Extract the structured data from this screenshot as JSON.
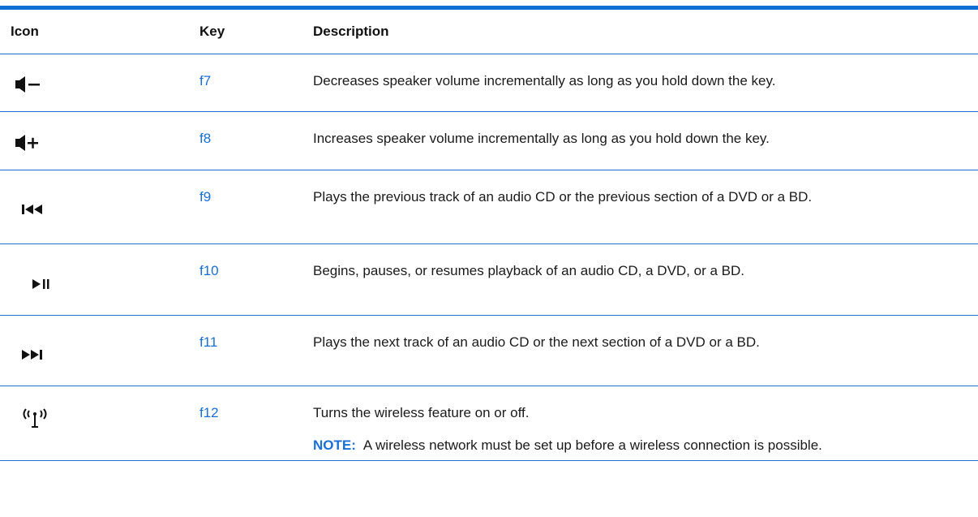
{
  "table": {
    "headers": {
      "icon": "Icon",
      "key": "Key",
      "description": "Description"
    },
    "rows": [
      {
        "icon": "volume-down-icon",
        "key": "f7",
        "description": "Decreases speaker volume incrementally as long as you hold down the key."
      },
      {
        "icon": "volume-up-icon",
        "key": "f8",
        "description": "Increases speaker volume incrementally as long as you hold down the key."
      },
      {
        "icon": "previous-track-icon",
        "key": "f9",
        "description": "Plays the previous track of an audio CD or the previous section of a DVD or a BD."
      },
      {
        "icon": "play-pause-icon",
        "key": "f10",
        "description": "Begins, pauses, or resumes playback of an audio CD, a DVD, or a BD."
      },
      {
        "icon": "next-track-icon",
        "key": "f11",
        "description": "Plays the next track of an audio CD or the next section of a DVD or a BD."
      },
      {
        "icon": "wireless-icon",
        "key": "f12",
        "description": "Turns the wireless feature on or off.",
        "note_label": "NOTE:",
        "note_text": "A wireless network must be set up before a wireless connection is possible."
      }
    ]
  },
  "colors": {
    "rule": "#1f6fd1",
    "key_link": "#1a6fd6"
  }
}
